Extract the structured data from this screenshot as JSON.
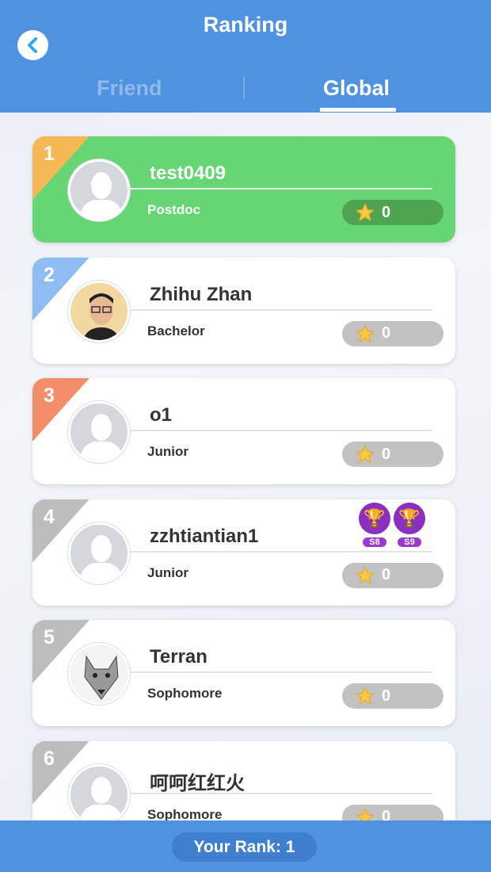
{
  "header": {
    "title": "Ranking",
    "tabs": [
      {
        "label": "Friend",
        "active": false
      },
      {
        "label": "Global",
        "active": true
      }
    ]
  },
  "colors": {
    "gold": "#f4b955",
    "silver": "#8dbcf3",
    "bronze": "#f28f6a",
    "default": "#bdbdbd",
    "me": "#66d574"
  },
  "rows": [
    {
      "rank": "1",
      "name": "test0409",
      "level": "Postdoc",
      "score": "0",
      "me": true,
      "avatar": "default-avatar-icon",
      "badges": []
    },
    {
      "rank": "2",
      "name": "Zhihu Zhan",
      "level": "Bachelor",
      "score": "0",
      "avatar": "photo-avatar",
      "badges": []
    },
    {
      "rank": "3",
      "name": "o1",
      "level": "Junior",
      "score": "0",
      "avatar": "default-avatar-icon",
      "badges": []
    },
    {
      "rank": "4",
      "name": "zzhtiantian1",
      "level": "Junior",
      "score": "0",
      "avatar": "default-avatar-icon",
      "badges": [
        "S8",
        "S9"
      ]
    },
    {
      "rank": "5",
      "name": "Terran",
      "level": "Sophomore",
      "score": "0",
      "avatar": "wolf-avatar",
      "badges": []
    },
    {
      "rank": "6",
      "name": "呵呵红红火",
      "level": "Sophomore",
      "score": "0",
      "avatar": "default-avatar-icon",
      "badges": []
    }
  ],
  "footer": {
    "your_rank": "Your Rank: 1"
  }
}
